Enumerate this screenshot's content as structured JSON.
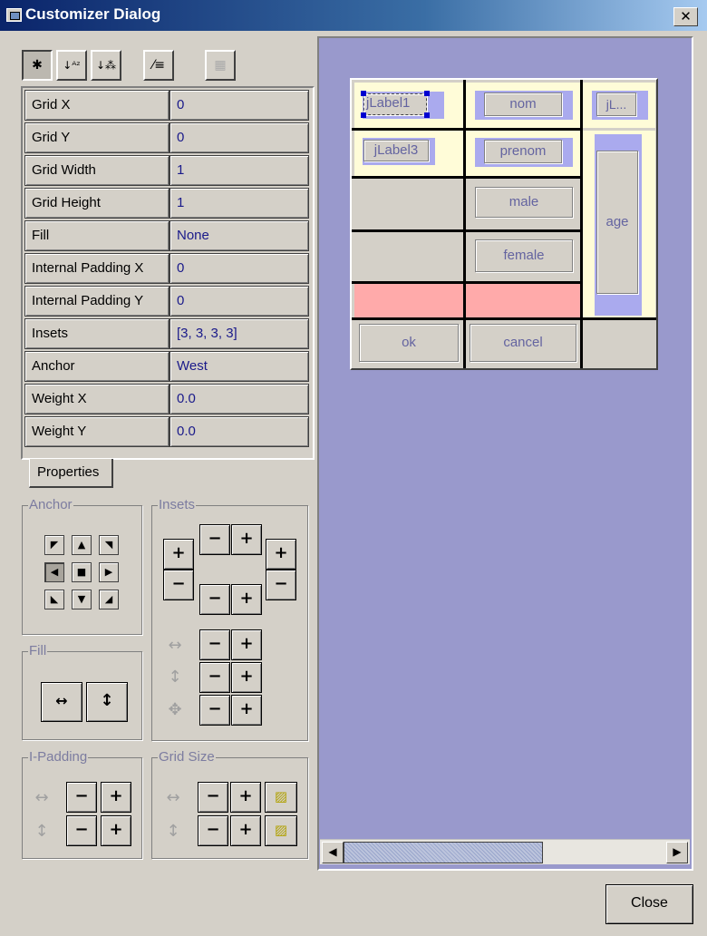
{
  "window": {
    "title": "Customizer Dialog",
    "close_glyph": "✕"
  },
  "toolbar": {
    "buttons": [
      {
        "name": "sort-by-category-icon",
        "glyph": "✱",
        "pressed": true
      },
      {
        "name": "sort-alphabetical-icon",
        "glyph": "↓ᴬᶻ"
      },
      {
        "name": "sort-custom-icon",
        "glyph": "↓⁂"
      },
      {
        "name": "edit-list-icon",
        "glyph": "⁄≡"
      },
      {
        "name": "table-disabled-icon",
        "glyph": "▦",
        "disabled": true
      }
    ]
  },
  "properties": [
    {
      "name": "Grid X",
      "value": "0"
    },
    {
      "name": "Grid Y",
      "value": "0"
    },
    {
      "name": "Grid Width",
      "value": "1"
    },
    {
      "name": "Grid Height",
      "value": "1"
    },
    {
      "name": "Fill",
      "value": "None"
    },
    {
      "name": "Internal Padding X",
      "value": "0"
    },
    {
      "name": "Internal Padding Y",
      "value": "0"
    },
    {
      "name": "Insets",
      "value": "[3, 3, 3, 3]"
    },
    {
      "name": "Anchor",
      "value": "West"
    },
    {
      "name": "Weight X",
      "value": "0.0"
    },
    {
      "name": "Weight Y",
      "value": "0.0"
    }
  ],
  "tab_properties": "Properties",
  "groups": {
    "anchor": "Anchor",
    "insets": "Insets",
    "fill": "Fill",
    "ipadding": "I-Padding",
    "gridsize": "Grid Size"
  },
  "anchor": {
    "selected": "West",
    "glyphs": [
      "◤",
      "▲",
      "◥",
      "◀",
      "■",
      "▶",
      "◣",
      "▼",
      "◢"
    ]
  },
  "step": {
    "minus": "−",
    "plus": "+"
  },
  "fill_icons": {
    "horizontal": "↔",
    "vertical": "↕"
  },
  "dim_icons": {
    "horizontal": "↔",
    "vertical": "↕",
    "both": "✥"
  },
  "gridsize_extra_glyph": "▨",
  "preview": {
    "cells": {
      "jlabel1": "jLabel1",
      "nom": "nom",
      "jl": "jL...",
      "jlabel3": "jLabel3",
      "prenom": "prenom",
      "male": "male",
      "age": "age",
      "female": "female",
      "ok": "ok",
      "cancel": "cancel"
    },
    "colors": {
      "background": "#9999cc",
      "highlight": "#ffaaaa",
      "cell_fill": "#aaaaee",
      "selection": "#0000d0"
    }
  },
  "scrollbar": {
    "left": "◀",
    "right": "▶"
  },
  "close_button": "Close"
}
